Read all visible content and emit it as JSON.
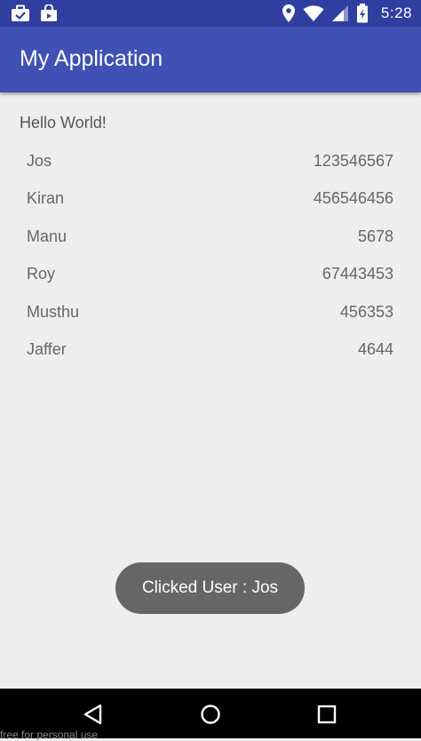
{
  "status_bar": {
    "time": "5:28",
    "left_icons": [
      "briefcase-check-icon",
      "shopping-bag-icon"
    ],
    "right_icons": [
      "location-icon",
      "wifi-icon",
      "cell-signal-icon",
      "battery-icon"
    ]
  },
  "app_bar": {
    "title": "My Application",
    "color": "#3f51b5"
  },
  "content": {
    "hello": "Hello World!",
    "users": [
      {
        "name": "Jos",
        "phone": "123546567"
      },
      {
        "name": "Kiran",
        "phone": "456546456"
      },
      {
        "name": "Manu",
        "phone": "5678"
      },
      {
        "name": "Roy",
        "phone": "67443453"
      },
      {
        "name": "Musthu",
        "phone": "456353"
      },
      {
        "name": "Jaffer",
        "phone": "4644"
      }
    ]
  },
  "toast": {
    "text": "Clicked User : Jos"
  },
  "nav_bar": {
    "buttons": [
      "back-icon",
      "home-icon",
      "recents-icon"
    ]
  },
  "watermark": "free for personal use"
}
